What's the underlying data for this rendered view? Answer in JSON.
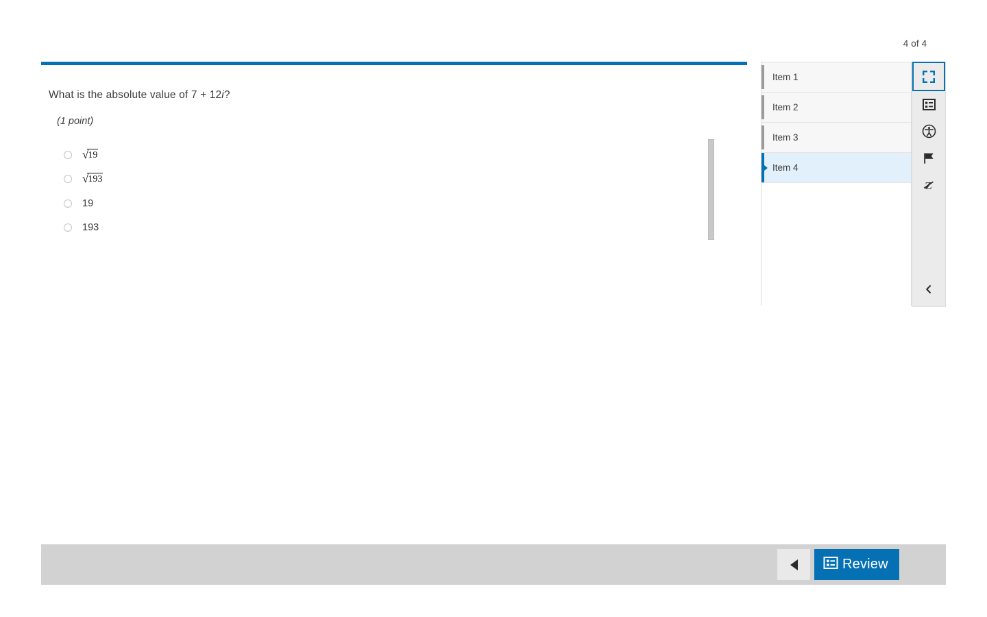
{
  "header": {
    "page_counter": "4 of 4"
  },
  "question": {
    "prompt_prefix": "What is the absolute value of 7 + 12",
    "prompt_italic": "i",
    "prompt_suffix": "?",
    "point_value": "(1 point)",
    "options": [
      {
        "id": "option-a",
        "type": "radical",
        "radicand": "19",
        "text": "√19",
        "selected": false
      },
      {
        "id": "option-b",
        "type": "radical",
        "radicand": "193",
        "text": "√193",
        "selected": false
      },
      {
        "id": "option-c",
        "type": "plain",
        "text": "19",
        "selected": false
      },
      {
        "id": "option-d",
        "type": "plain",
        "text": "193",
        "selected": false
      }
    ]
  },
  "item_panel": {
    "items": [
      {
        "label": "Item 1",
        "current": false
      },
      {
        "label": "Item 2",
        "current": false
      },
      {
        "label": "Item 3",
        "current": false
      },
      {
        "label": "Item 4",
        "current": true
      }
    ]
  },
  "tool_rail": {
    "buttons": [
      {
        "icon": "fullscreen-icon",
        "label": "Full Screen",
        "active": true
      },
      {
        "icon": "review-list-icon",
        "label": "Review",
        "active": false
      },
      {
        "icon": "accessibility-icon",
        "label": "Accessibility",
        "active": false
      },
      {
        "icon": "flag-icon",
        "label": "Flag",
        "active": false
      },
      {
        "icon": "line-reader-icon",
        "label": "Line Reader",
        "active": false
      }
    ],
    "collapse": {
      "icon": "chevron-left-icon",
      "label": "Collapse"
    }
  },
  "footer": {
    "previous_label": "Previous",
    "review_label": "Review"
  },
  "colors": {
    "accent": "#0571b4",
    "footer_bar": "#d2d2d2",
    "current_item_bg": "#e2f0fb",
    "rail_bg": "#ebebeb"
  }
}
